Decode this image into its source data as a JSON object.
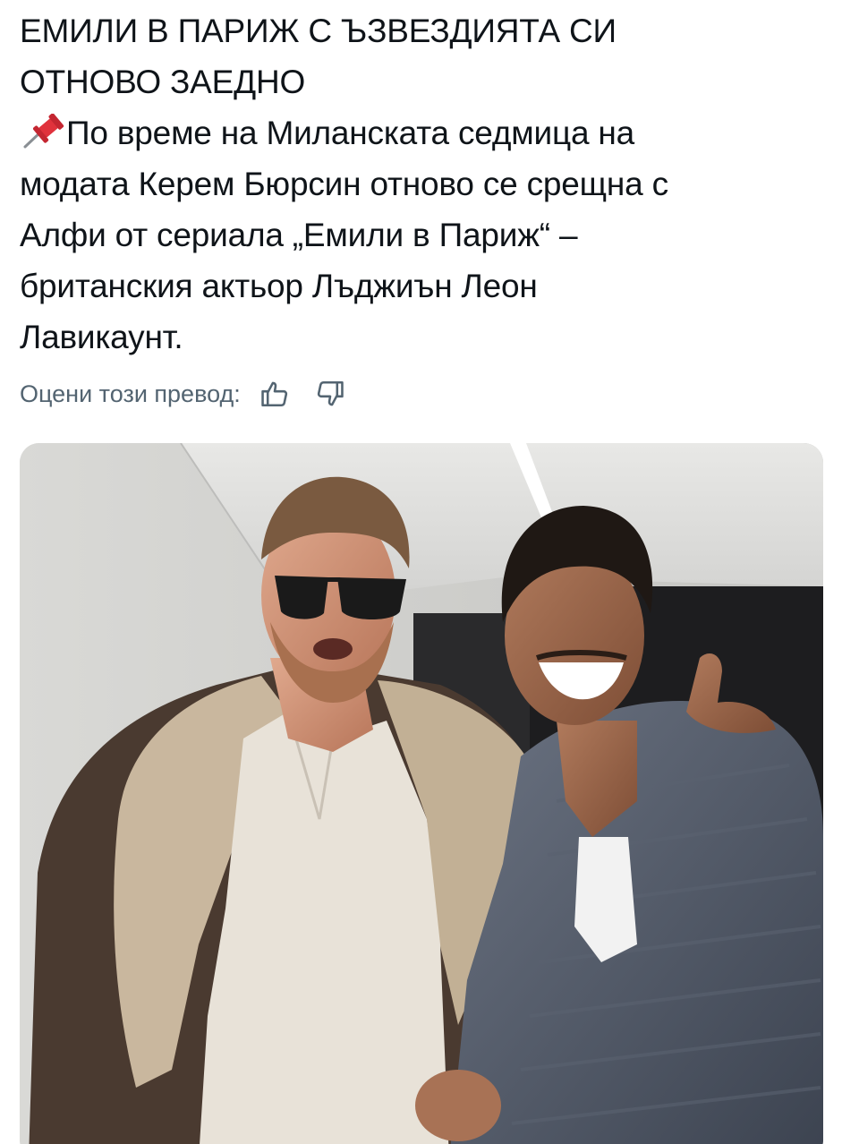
{
  "post": {
    "title_lines": [
      "ЕМИЛИ В ПАРИЖ С ЪЗВЕЗДИЯТА СИ",
      "ОТНОВО ЗАЕДНО"
    ],
    "pin_icon": "pushpin-icon",
    "body_lines": [
      "По време на Миланската седмица на",
      "модата Керем Бюрсин отново се срещна с",
      "Алфи от сериала „Емили в Париж“ –",
      "британския актьор Лъджиън Леон",
      "Лавикаунт."
    ]
  },
  "translation_rating": {
    "label": "Оцени този превод:",
    "thumbs_up_icon": "thumbs-up-icon",
    "thumbs_down_icon": "thumbs-down-icon"
  },
  "media": {
    "type": "photo",
    "icon": "photo-two-men"
  },
  "colors": {
    "text": "#0f1419",
    "secondary_text": "#536471",
    "pin_red": "#e0323c"
  }
}
